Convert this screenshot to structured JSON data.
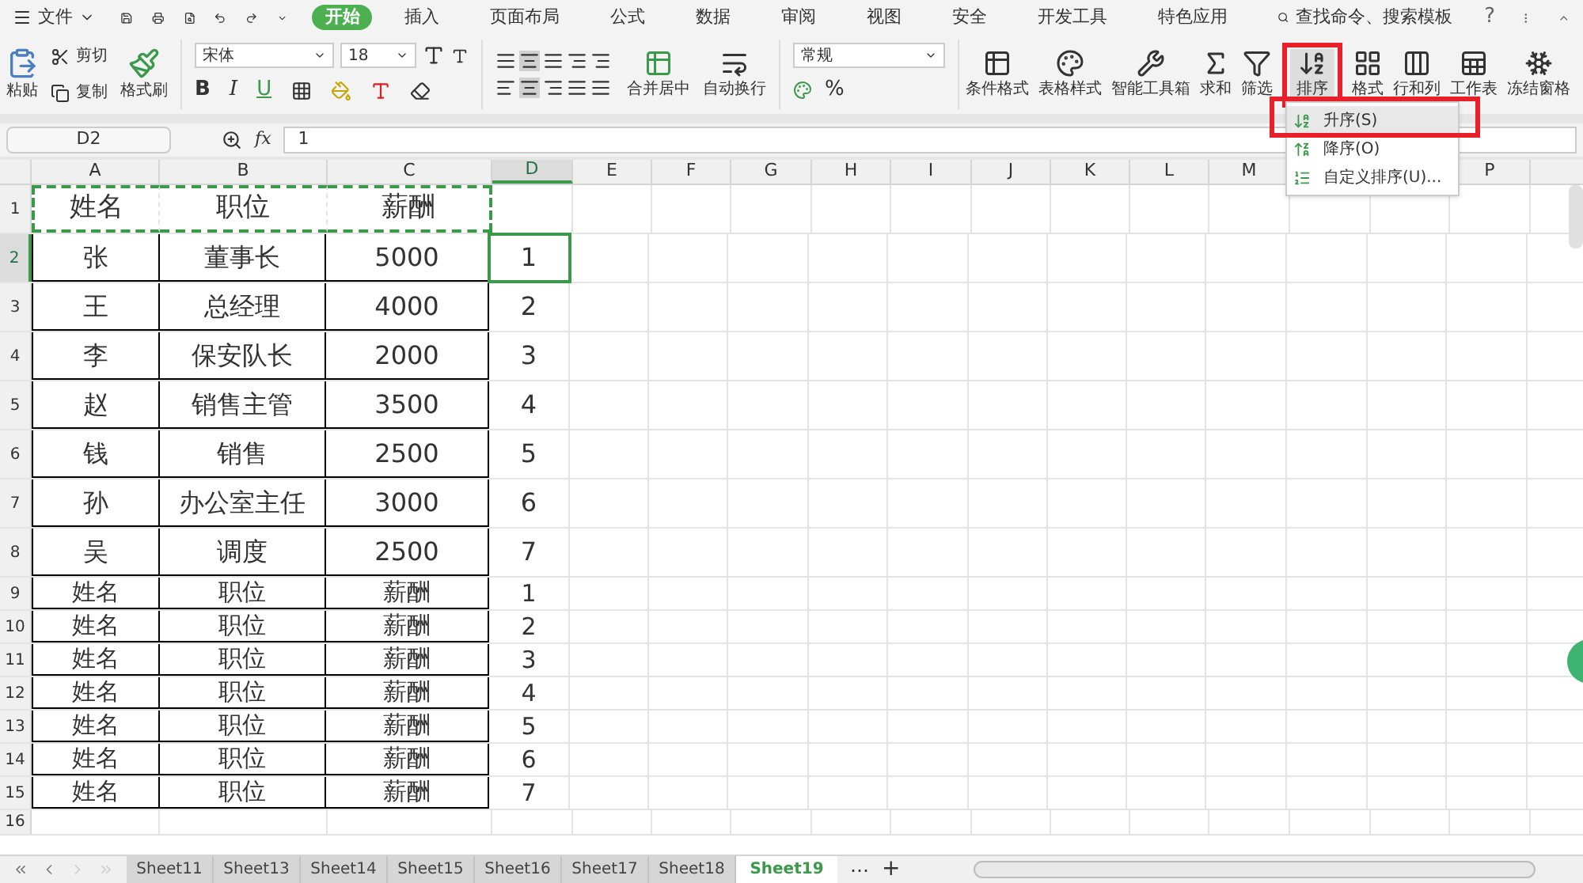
{
  "menu_bar": {
    "file_menu": "文件",
    "tabs": [
      {
        "label": "开始",
        "selected": true
      },
      {
        "label": "插入",
        "selected": false
      },
      {
        "label": "页面布局",
        "selected": false
      },
      {
        "label": "公式",
        "selected": false
      },
      {
        "label": "数据",
        "selected": false
      },
      {
        "label": "审阅",
        "selected": false
      },
      {
        "label": "视图",
        "selected": false
      },
      {
        "label": "安全",
        "selected": false
      },
      {
        "label": "开发工具",
        "selected": false
      },
      {
        "label": "特色应用",
        "selected": false
      }
    ],
    "search": "查找命令、搜索模板",
    "help": "?"
  },
  "ribbon": {
    "paste": "粘贴",
    "cut": "剪切",
    "copy": "复制",
    "format_painter": "格式刷",
    "font_name": "宋体",
    "font_size": "18",
    "bold": "B",
    "italic": "I",
    "underline": "U",
    "merge": "合并居中",
    "wrap": "自动换行",
    "number_format": "常规",
    "percent": "%",
    "tools": [
      {
        "label": "条件格式",
        "kind": "conditional"
      },
      {
        "label": "表格样式",
        "kind": "style"
      },
      {
        "label": "智能工具箱",
        "kind": "toolbox"
      },
      {
        "label": "求和",
        "kind": "sum"
      },
      {
        "label": "筛选",
        "kind": "filter"
      },
      {
        "label": "排序",
        "kind": "sort"
      },
      {
        "label": "格式",
        "kind": "format"
      },
      {
        "label": "行和列",
        "kind": "rowcol"
      },
      {
        "label": "工作表",
        "kind": "sheet"
      },
      {
        "label": "冻结窗格",
        "kind": "freeze"
      }
    ]
  },
  "sort_menu": [
    {
      "label": "升序(S)",
      "kind": "ascending",
      "selected": true
    },
    {
      "label": "降序(O)",
      "kind": "descending",
      "selected": false
    },
    {
      "label": "自定义排序(U)...",
      "kind": "custom",
      "selected": false
    }
  ],
  "formula_bar": {
    "name_box": "D2",
    "fx": "fx",
    "value": "1"
  },
  "columns": [
    {
      "letter": "A",
      "selected": false
    },
    {
      "letter": "B",
      "selected": false
    },
    {
      "letter": "C",
      "selected": false
    },
    {
      "letter": "D",
      "selected": true
    },
    {
      "letter": "E",
      "selected": false
    },
    {
      "letter": "F",
      "selected": false
    },
    {
      "letter": "G",
      "selected": false
    },
    {
      "letter": "H",
      "selected": false
    },
    {
      "letter": "I",
      "selected": false
    },
    {
      "letter": "J",
      "selected": false
    },
    {
      "letter": "K",
      "selected": false
    },
    {
      "letter": "L",
      "selected": false
    },
    {
      "letter": "M",
      "selected": false
    }
  ],
  "columns_right": [
    {
      "letter": "P",
      "selected": false
    }
  ],
  "rows": [
    {
      "header": "1",
      "kind": "copied",
      "selected": false,
      "cells": [
        "姓名",
        "职位",
        "薪酬"
      ]
    },
    {
      "header": "2",
      "kind": "tall",
      "selected": true,
      "cells": [
        "张",
        "董事长",
        "5000",
        "1"
      ]
    },
    {
      "header": "3",
      "kind": "tall",
      "selected": false,
      "cells": [
        "王",
        "总经理",
        "4000",
        "2"
      ]
    },
    {
      "header": "4",
      "kind": "tall",
      "selected": false,
      "cells": [
        "李",
        "保安队长",
        "2000",
        "3"
      ]
    },
    {
      "header": "5",
      "kind": "tall",
      "selected": false,
      "cells": [
        "赵",
        "销售主管",
        "3500",
        "4"
      ]
    },
    {
      "header": "6",
      "kind": "tall",
      "selected": false,
      "cells": [
        "钱",
        "销售",
        "2500",
        "5"
      ]
    },
    {
      "header": "7",
      "kind": "tall",
      "selected": false,
      "cells": [
        "孙",
        "办公室主任",
        "3000",
        "6"
      ]
    },
    {
      "header": "8",
      "kind": "tall",
      "selected": false,
      "cells": [
        "吴",
        "调度",
        "2500",
        "7"
      ]
    },
    {
      "header": "9",
      "kind": "compact",
      "selected": false,
      "cells": [
        "姓名",
        "职位",
        "薪酬",
        "1"
      ]
    },
    {
      "header": "10",
      "kind": "compact",
      "selected": false,
      "cells": [
        "姓名",
        "职位",
        "薪酬",
        "2"
      ]
    },
    {
      "header": "11",
      "kind": "compact",
      "selected": false,
      "cells": [
        "姓名",
        "职位",
        "薪酬",
        "3"
      ]
    },
    {
      "header": "12",
      "kind": "compact",
      "selected": false,
      "cells": [
        "姓名",
        "职位",
        "薪酬",
        "4"
      ]
    },
    {
      "header": "13",
      "kind": "compact",
      "selected": false,
      "cells": [
        "姓名",
        "职位",
        "薪酬",
        "5"
      ]
    },
    {
      "header": "14",
      "kind": "compact",
      "selected": false,
      "cells": [
        "姓名",
        "职位",
        "薪酬",
        "6"
      ]
    },
    {
      "header": "15",
      "kind": "compact",
      "selected": false,
      "cells": [
        "姓名",
        "职位",
        "薪酬",
        "7"
      ]
    },
    {
      "header": "16",
      "kind": "empty",
      "selected": false,
      "cells": []
    }
  ],
  "sheet_tabs": [
    {
      "label": "Sheet11",
      "selected": false
    },
    {
      "label": "Sheet13",
      "selected": false
    },
    {
      "label": "Sheet14",
      "selected": false
    },
    {
      "label": "Sheet15",
      "selected": false
    },
    {
      "label": "Sheet16",
      "selected": false
    },
    {
      "label": "Sheet17",
      "selected": false
    },
    {
      "label": "Sheet18",
      "selected": false
    },
    {
      "label": "Sheet19",
      "selected": true
    }
  ],
  "more_sheets": "⋯",
  "add_sheet": "+"
}
